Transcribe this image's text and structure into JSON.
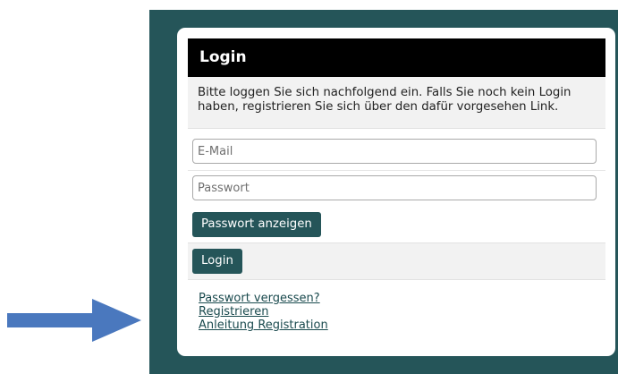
{
  "login_card": {
    "title": "Login",
    "info_text": "Bitte loggen Sie sich nachfolgend ein. Falls Sie noch kein Login haben, registrieren Sie sich über den dafür vorgesehen Link.",
    "email_placeholder": "E-Mail",
    "password_placeholder": "Passwort",
    "show_password_label": "Passwort anzeigen",
    "login_button_label": "Login",
    "links": {
      "forgot_password": "Passwort vergessen?",
      "register": "Registrieren",
      "registration_guide": "Anleitung Registration"
    }
  },
  "icons": {
    "pointer_arrow": "arrow-right-icon"
  },
  "colors": {
    "panel_background": "#255559",
    "header_background": "#000000",
    "button_background": "#255559",
    "arrow_color": "#4a78be"
  }
}
